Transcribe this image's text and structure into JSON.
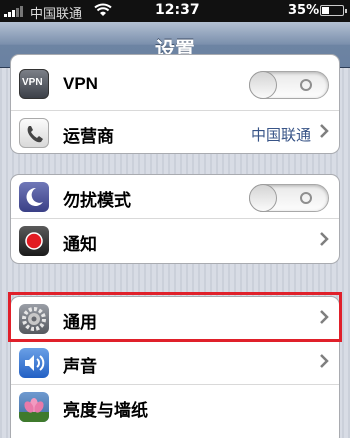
{
  "status_bar": {
    "carrier": "中国联通",
    "time": "12:37",
    "battery": "35%",
    "battery_level": 0.35
  },
  "nav": {
    "title": "设置"
  },
  "group1": {
    "rows": [
      {
        "label": "VPN",
        "icon": "vpn-icon",
        "icon_text": "VPN",
        "toggle": "off"
      },
      {
        "label": "运营商",
        "icon": "phone-icon",
        "value": "中国联通"
      }
    ]
  },
  "group2": {
    "rows": [
      {
        "label": "勿扰模式",
        "icon": "moon-icon",
        "toggle": "off"
      },
      {
        "label": "通知",
        "icon": "notification-icon"
      }
    ]
  },
  "group3": {
    "rows": [
      {
        "label": "通用",
        "icon": "gear-icon",
        "highlighted": true
      },
      {
        "label": "声音",
        "icon": "speaker-icon"
      },
      {
        "label": "亮度与墙纸",
        "icon": "flower-icon"
      }
    ]
  },
  "colors": {
    "highlight": "#e0202a",
    "value_text": "#385487",
    "nav_bar": "#6d84a3"
  }
}
